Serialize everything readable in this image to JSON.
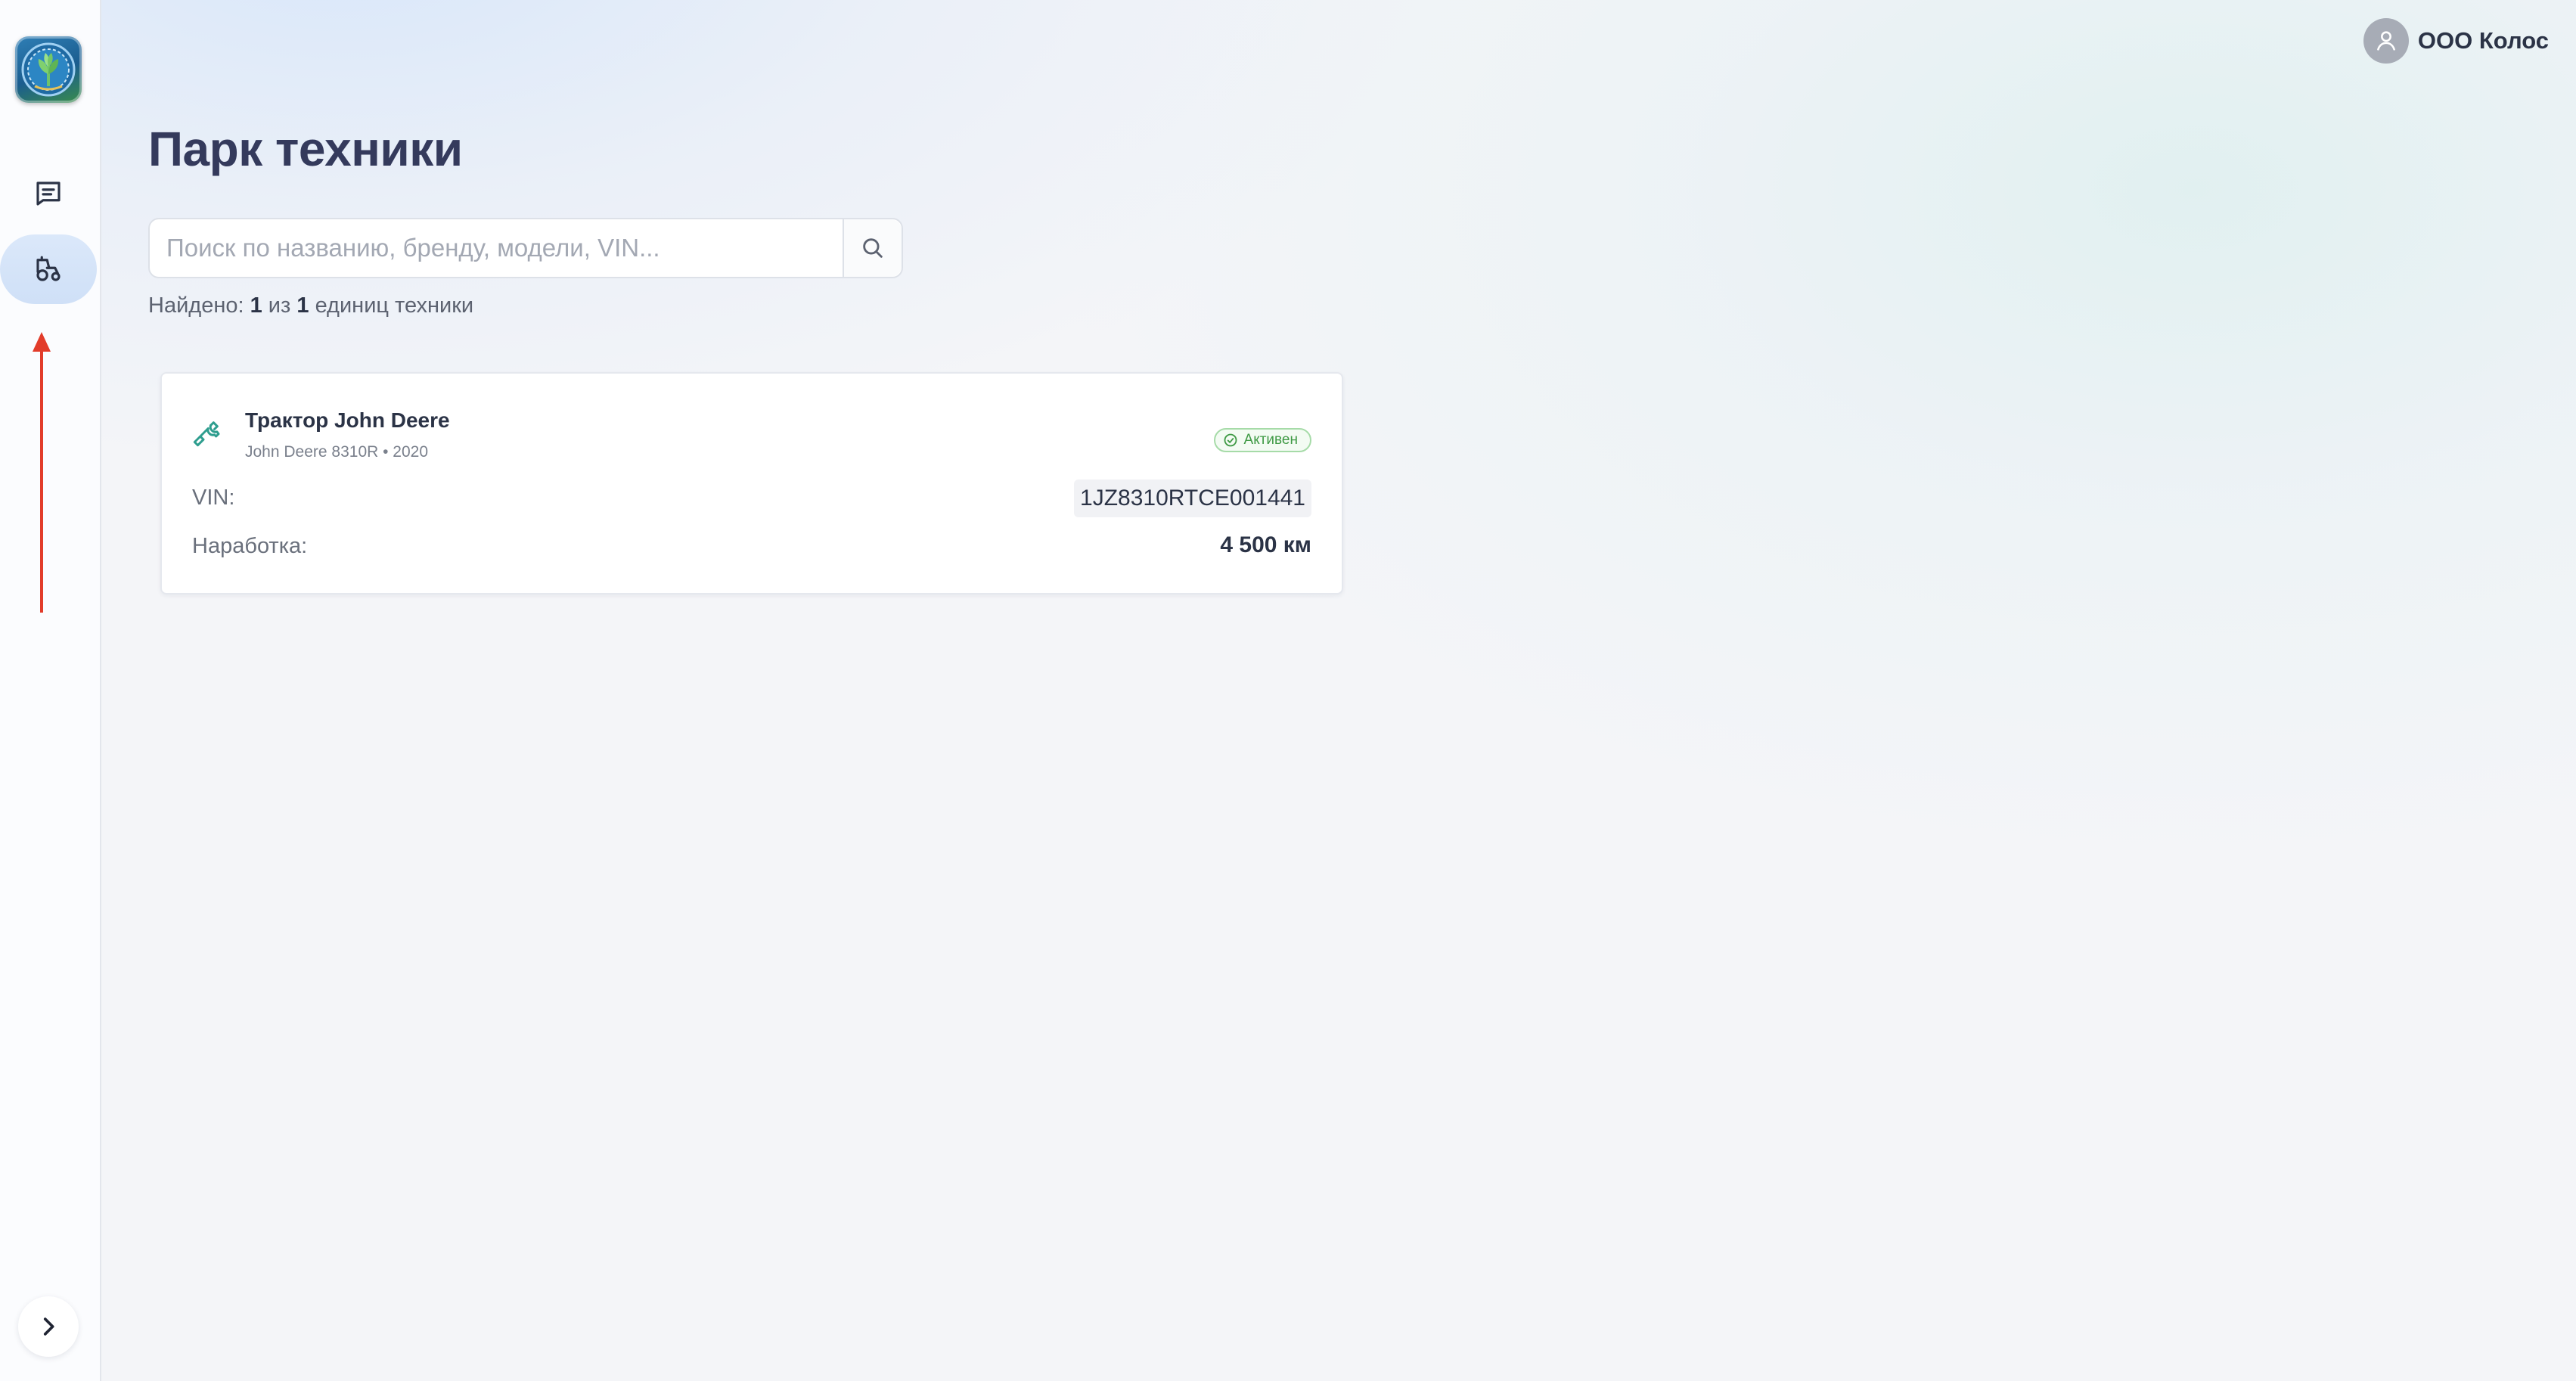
{
  "user": {
    "name": "ООО Колос"
  },
  "page": {
    "title": "Парк техники"
  },
  "search": {
    "placeholder": "Поиск по названию, бренду, модели, VIN..."
  },
  "results": {
    "prefix": "Найдено:",
    "shown": "1",
    "of": "из",
    "total": "1",
    "suffix": "единиц техники"
  },
  "vehicles": [
    {
      "title": "Трактор John Deere",
      "subtitle": "John Deere 8310R • 2020",
      "status": "Активен",
      "vin_label": "VIN:",
      "vin": "1JZ8310RTCE001441",
      "mileage_label": "Наработка:",
      "mileage": "4 500 км"
    }
  ],
  "sidebar": {
    "items": [
      {
        "icon": "message-list-icon",
        "active": false
      },
      {
        "icon": "tractor-icon",
        "active": true
      }
    ]
  },
  "colors": {
    "accent": "#2f9e8f",
    "status_green": "#3f9a45",
    "title": "#343a5c",
    "annotation_arrow": "#e23c2a"
  }
}
